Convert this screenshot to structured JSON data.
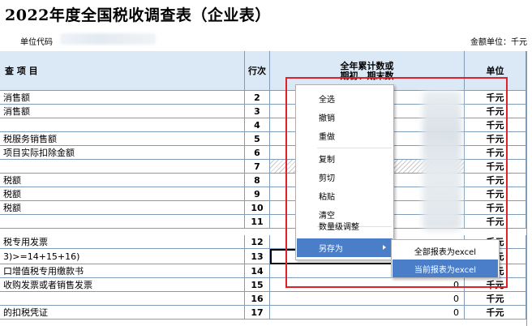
{
  "title": "2022年度全国税收调查表（企业表）",
  "unit_code_label": "单位代码",
  "amount_unit": "金额单位：千元",
  "headers": {
    "item": "查 项 目",
    "line": "行次",
    "value_line1": "全年累计数或",
    "value_line2": "期初、期末数",
    "unit": "单位"
  },
  "rows": [
    {
      "item": "消售额",
      "line": "2",
      "value": "",
      "unit": "千元"
    },
    {
      "item": "消售额",
      "line": "3",
      "value": "",
      "unit": "千元"
    },
    {
      "item": "",
      "line": "4",
      "value": "",
      "unit": "千元"
    },
    {
      "item": "税服务销售额",
      "line": "5",
      "value": "",
      "unit": "千元"
    },
    {
      "item": "项目实际扣除金额",
      "line": "6",
      "value": "",
      "unit": "千元"
    },
    {
      "item": "",
      "line": "7",
      "value": "",
      "unit": "千元"
    },
    {
      "item": "税额",
      "line": "8",
      "value": "",
      "unit": "千元"
    },
    {
      "item": "税额",
      "line": "9",
      "value": "",
      "unit": "千元"
    },
    {
      "item": "税额",
      "line": "10",
      "value": "",
      "unit": "千元"
    },
    {
      "item": "",
      "line": "11",
      "value": "",
      "unit": "千元"
    },
    {
      "item": "税专用发票",
      "line": "12",
      "value": "",
      "unit": "千元"
    },
    {
      "item": "3)>=14+15+16)",
      "line": "13",
      "value": "",
      "unit": "千元"
    },
    {
      "item": "口增值税专用缴款书",
      "line": "14",
      "value": "",
      "unit": "千元"
    },
    {
      "item": "收购发票或者销售发票",
      "line": "15",
      "value": "0",
      "unit": "千元"
    },
    {
      "item": "",
      "line": "16",
      "value": "0",
      "unit": "千元"
    },
    {
      "item": "的扣税凭证",
      "line": "17",
      "value": "0",
      "unit": "千元"
    }
  ],
  "context_menu": {
    "items": [
      "全选",
      "撤销",
      "重做",
      "复制",
      "剪切",
      "粘贴",
      "清空",
      "数量级调整",
      "另存为"
    ]
  },
  "submenu": {
    "items": [
      "全部报表为excel",
      "当前报表为excel"
    ]
  },
  "colors": {
    "header_bg": "#dbe8f6",
    "grid_line": "#7f9db9",
    "menu_highlight": "#4a7ec8",
    "annotation": "#e0202a"
  }
}
